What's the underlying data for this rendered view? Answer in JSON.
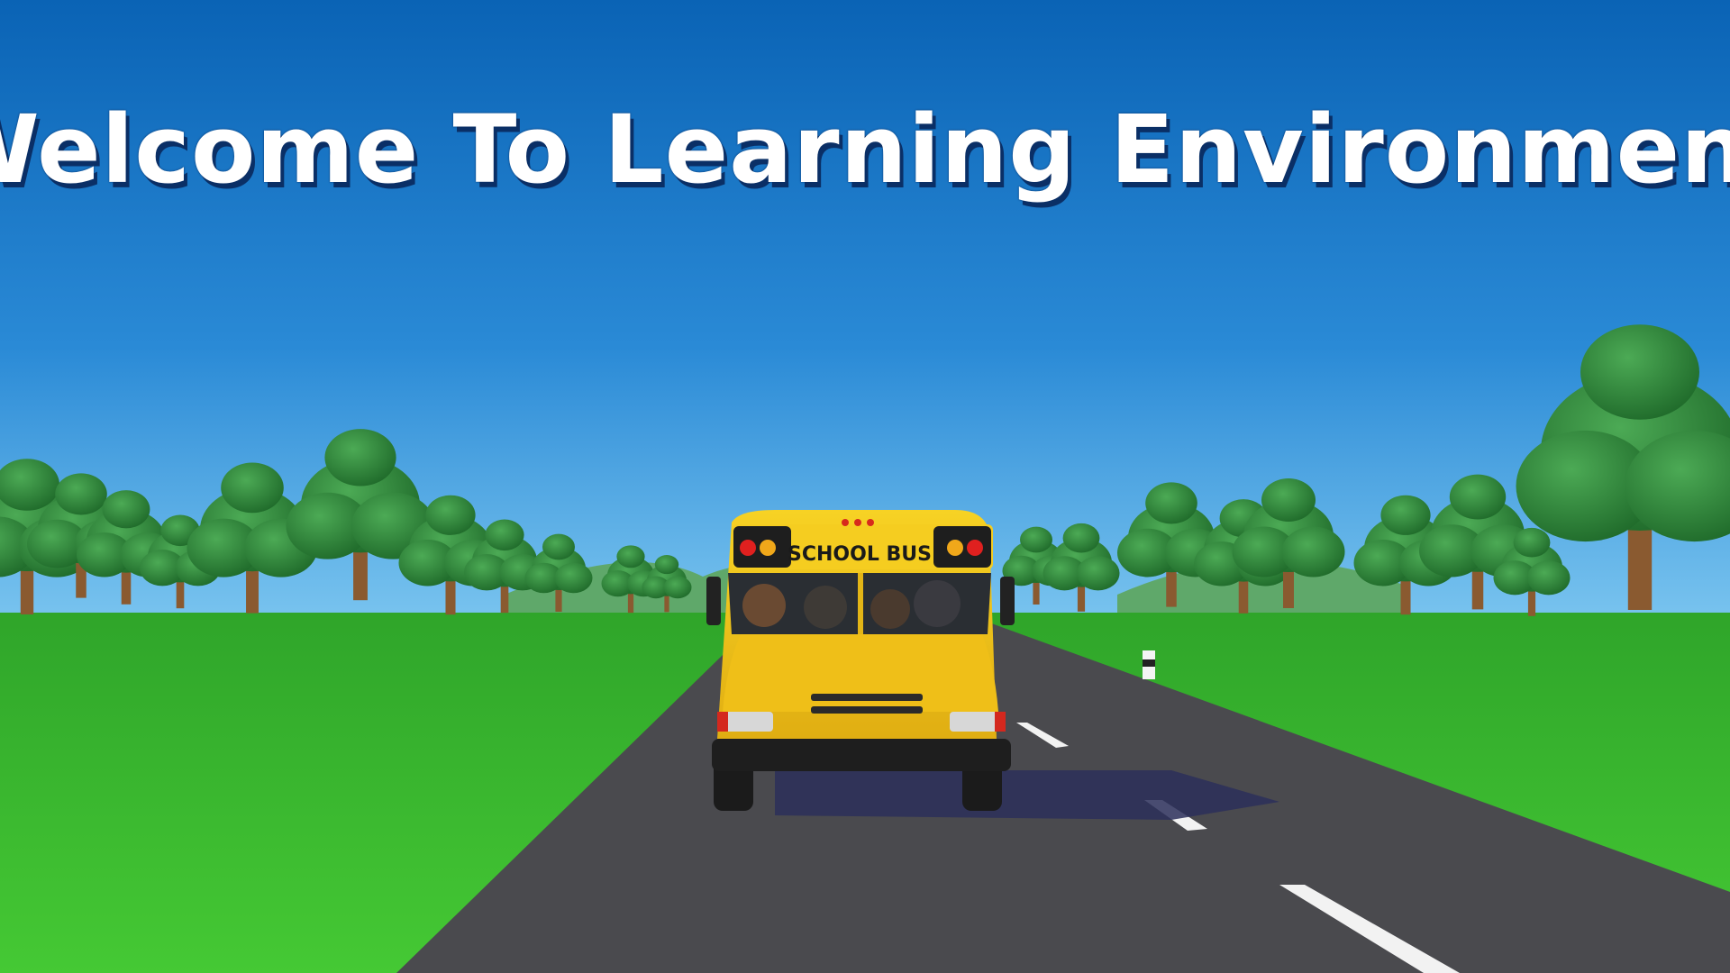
{
  "title": "Welcome To Learning Environment",
  "bus_sign": "SCHOOL BUS",
  "colors": {
    "sky_top": "#0a66b8",
    "sky_bottom": "#57b3ee",
    "grass": "#3cbf2e",
    "road": "#4a4a4e",
    "bus_yellow": "#f2c81c",
    "tree": "#2f8a3a"
  }
}
